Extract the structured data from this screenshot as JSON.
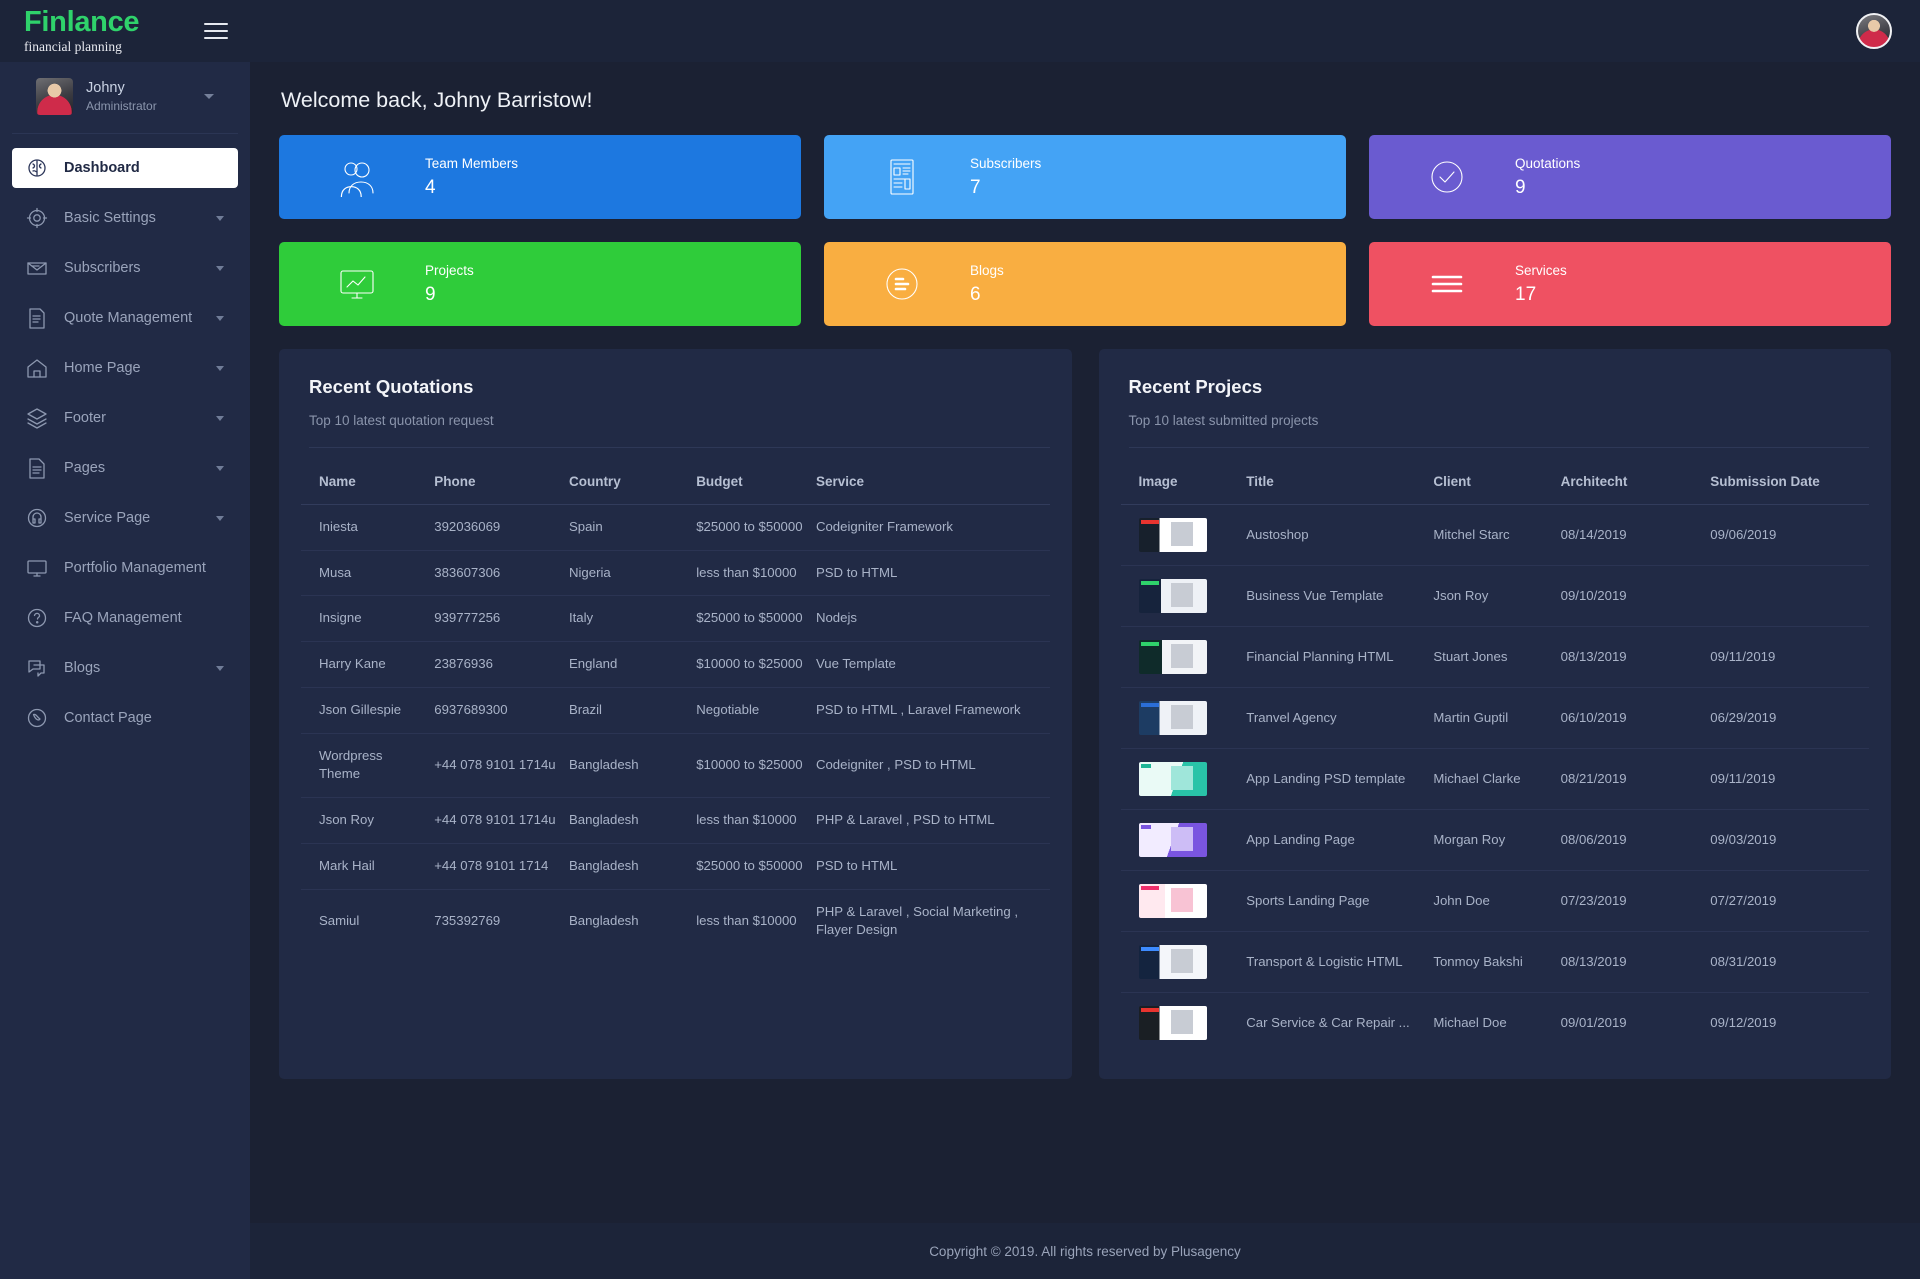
{
  "brand": {
    "name": "Finlance",
    "tagline": "financial planning"
  },
  "profile": {
    "name": "Johny",
    "role": "Administrator"
  },
  "sidebar": {
    "items": [
      {
        "label": "Dashboard",
        "icon": "brain-icon",
        "active": true,
        "caret": false
      },
      {
        "label": "Basic Settings",
        "icon": "gear-icon",
        "active": false,
        "caret": true
      },
      {
        "label": "Subscribers",
        "icon": "envelope-icon",
        "active": false,
        "caret": true
      },
      {
        "label": "Quote Management",
        "icon": "document-list-icon",
        "active": false,
        "caret": true
      },
      {
        "label": "Home Page",
        "icon": "home-icon",
        "active": false,
        "caret": true
      },
      {
        "label": "Footer",
        "icon": "layers-icon",
        "active": false,
        "caret": true
      },
      {
        "label": "Pages",
        "icon": "page-icon",
        "active": false,
        "caret": true
      },
      {
        "label": "Service Page",
        "icon": "headset-icon",
        "active": false,
        "caret": true
      },
      {
        "label": "Portfolio Management",
        "icon": "monitor-icon",
        "active": false,
        "caret": false
      },
      {
        "label": "FAQ Management",
        "icon": "question-icon",
        "active": false,
        "caret": false
      },
      {
        "label": "Blogs",
        "icon": "chat-icon",
        "active": false,
        "caret": true
      },
      {
        "label": "Contact Page",
        "icon": "phone-icon",
        "active": false,
        "caret": false
      }
    ]
  },
  "header": {
    "welcome": "Welcome back, Johny Barristow!"
  },
  "cards": [
    {
      "title": "Team Members",
      "value": "4",
      "color": "#1d78e0",
      "icon": "users-icon"
    },
    {
      "title": "Subscribers",
      "value": "7",
      "color": "#44a3f5",
      "icon": "newspaper-icon"
    },
    {
      "title": "Quotations",
      "value": "9",
      "color": "#6a5bd0",
      "icon": "check-circle-icon"
    },
    {
      "title": "Projects",
      "value": "9",
      "color": "#2fcc3a",
      "icon": "chart-monitor-icon"
    },
    {
      "title": "Blogs",
      "value": "6",
      "color": "#f9ae41",
      "icon": "blogger-icon"
    },
    {
      "title": "Services",
      "value": "17",
      "color": "#ef5162",
      "icon": "list-icon"
    }
  ],
  "quotations": {
    "title": "Recent Quotations",
    "subtitle": "Top 10 latest quotation request",
    "columns": [
      "Name",
      "Phone",
      "Country",
      "Budget",
      "Service"
    ],
    "rows": [
      {
        "name": "Iniesta",
        "phone": "392036069",
        "country": "Spain",
        "budget": "$25000 to $50000",
        "service": "Codeigniter Framework"
      },
      {
        "name": "Musa",
        "phone": "383607306",
        "country": "Nigeria",
        "budget": "less than $10000",
        "service": "PSD to HTML"
      },
      {
        "name": "Insigne",
        "phone": "939777256",
        "country": "Italy",
        "budget": "$25000 to $50000",
        "service": "Nodejs"
      },
      {
        "name": "Harry Kane",
        "phone": "23876936",
        "country": "England",
        "budget": "$10000 to $25000",
        "service": "Vue Template"
      },
      {
        "name": "Json Gillespie",
        "phone": "6937689300",
        "country": "Brazil",
        "budget": "Negotiable",
        "service": "PSD to HTML , Laravel Framework"
      },
      {
        "name": "Wordpress Theme",
        "phone": "+44 078 9101 1714u",
        "country": "Bangladesh",
        "budget": "$10000 to $25000",
        "service": "Codeigniter , PSD to HTML"
      },
      {
        "name": "Json Roy",
        "phone": "+44 078 9101 1714u",
        "country": "Bangladesh",
        "budget": "less than $10000",
        "service": "PHP & Laravel , PSD to HTML"
      },
      {
        "name": "Mark Hail",
        "phone": "+44 078 9101 1714",
        "country": "Bangladesh",
        "budget": "$25000 to $50000",
        "service": "PSD to HTML"
      },
      {
        "name": "Samiul",
        "phone": "735392769",
        "country": "Bangladesh",
        "budget": "less than $10000",
        "service": "PHP & Laravel , Social Marketing , Flayer Design"
      }
    ]
  },
  "projects": {
    "title": "Recent Projecs",
    "subtitle": "Top 10 latest submitted projects",
    "columns": [
      "Image",
      "Title",
      "Client",
      "Architecht",
      "Submission Date"
    ],
    "rows": [
      {
        "thumb": "t1",
        "title": "Austoshop",
        "client": "Mitchel Starc",
        "architect": "08/14/2019",
        "submitted": "09/06/2019"
      },
      {
        "thumb": "t2",
        "title": "Business Vue Template",
        "client": "Json Roy",
        "architect": "09/10/2019",
        "submitted": ""
      },
      {
        "thumb": "t3",
        "title": "Financial Planning HTML",
        "client": "Stuart Jones",
        "architect": "08/13/2019",
        "submitted": "09/11/2019"
      },
      {
        "thumb": "t4",
        "title": "Tranvel Agency",
        "client": "Martin Guptil",
        "architect": "06/10/2019",
        "submitted": "06/29/2019"
      },
      {
        "thumb": "t5",
        "title": "App Landing PSD template",
        "client": "Michael Clarke",
        "architect": "08/21/2019",
        "submitted": "09/11/2019"
      },
      {
        "thumb": "t6",
        "title": "App Landing Page",
        "client": "Morgan Roy",
        "architect": "08/06/2019",
        "submitted": "09/03/2019"
      },
      {
        "thumb": "t7",
        "title": "Sports Landing Page",
        "client": "John Doe",
        "architect": "07/23/2019",
        "submitted": "07/27/2019"
      },
      {
        "thumb": "t8",
        "title": "Transport & Logistic HTML",
        "client": "Tonmoy Bakshi",
        "architect": "08/13/2019",
        "submitted": "08/31/2019"
      },
      {
        "thumb": "t9",
        "title": "Car Service & Car Repair ...",
        "client": "Michael Doe",
        "architect": "09/01/2019",
        "submitted": "09/12/2019"
      }
    ]
  },
  "footer": {
    "copyright": "Copyright © 2019. All rights reserved by Plusagency"
  }
}
